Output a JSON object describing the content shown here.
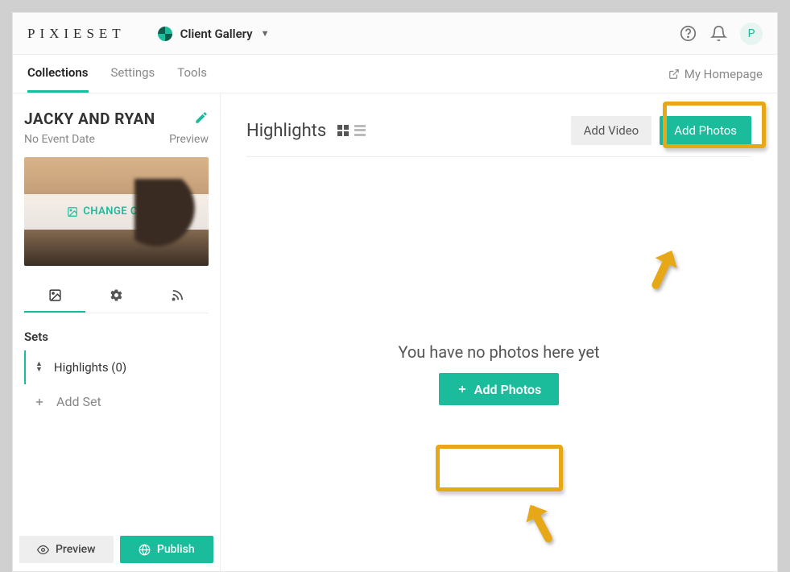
{
  "brand": "PIXIESET",
  "app_switcher": {
    "label": "Client Gallery",
    "icon": "client-gallery-icon"
  },
  "header": {
    "help_icon": "help-icon",
    "bell_icon": "notifications-icon",
    "avatar_letter": "P",
    "tabs": [
      {
        "label": "Collections",
        "active": true
      },
      {
        "label": "Settings",
        "active": false
      },
      {
        "label": "Tools",
        "active": false
      }
    ],
    "my_homepage": "My Homepage"
  },
  "sidebar": {
    "collection_title": "JACKY AND RYAN",
    "no_event_date": "No Event Date",
    "preview_label": "Preview",
    "change_cover": "CHANGE COVER",
    "sets_label": "Sets",
    "set_items": [
      {
        "label": "Highlights (0)"
      }
    ],
    "add_set": "Add Set",
    "footer": {
      "preview": "Preview",
      "publish": "Publish"
    }
  },
  "main": {
    "title": "Highlights",
    "add_video": "Add Video",
    "add_photos": "Add Photos",
    "empty_text": "You have no photos here yet",
    "add_photos_center": "Add Photos"
  },
  "colors": {
    "accent": "#1abc9c",
    "highlight": "#e6a817"
  }
}
